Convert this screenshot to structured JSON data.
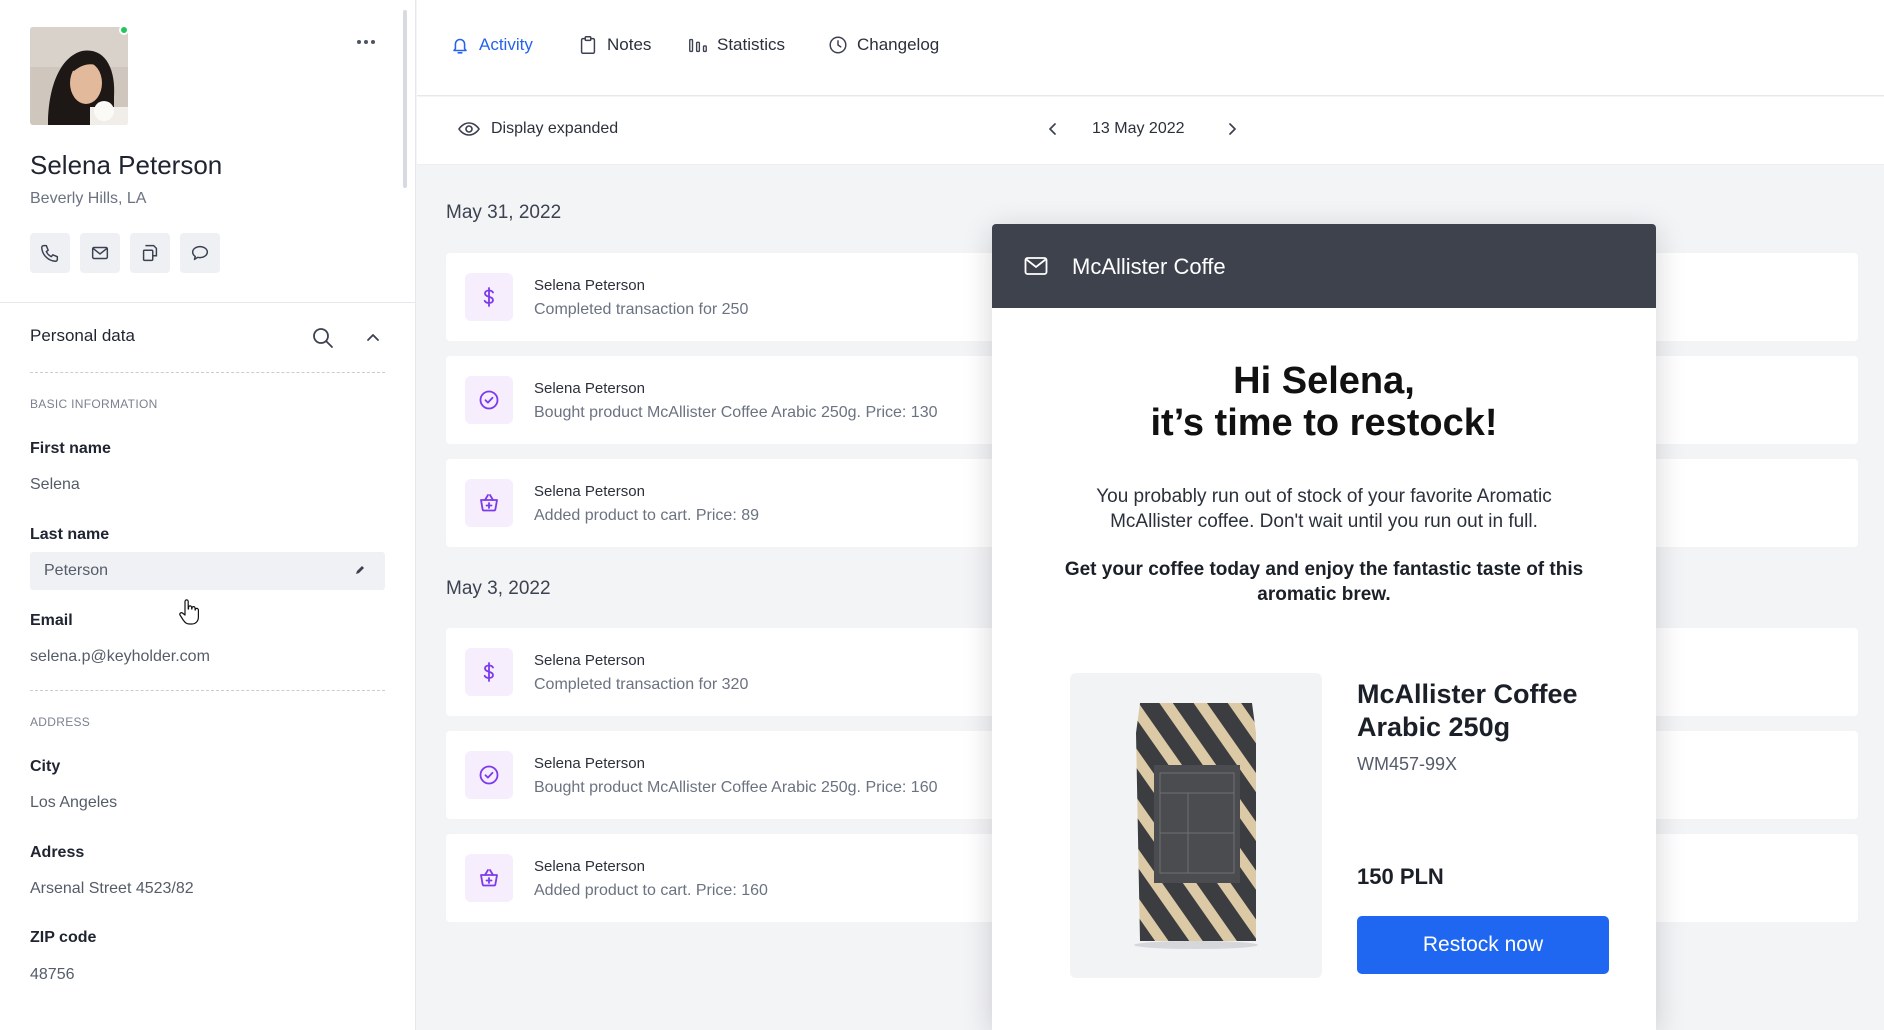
{
  "profile": {
    "name": "Selena Peterson",
    "location": "Beverly Hills, LA",
    "more_icon": "more-horizontal-icon",
    "online_status_color": "#22c55e",
    "contact_actions": [
      "phone-icon",
      "mail-icon",
      "copy-icon",
      "chat-icon"
    ]
  },
  "personal_data": {
    "title": "Personal data",
    "basic_label": "BASIC INFORMATION",
    "first_name_label": "First name",
    "first_name_value": "Selena",
    "last_name_label": "Last name",
    "last_name_value": "Peterson",
    "email_label": "Email",
    "email_value": "selena.p@keyholder.com",
    "address_label": "ADDRESS",
    "city_label": "City",
    "city_value": "Los Angeles",
    "adress_label": "Adress",
    "adress_value": "Arsenal Street 4523/82",
    "zip_label": "ZIP code",
    "zip_value": "48756"
  },
  "tabs": [
    {
      "label": "Activity",
      "icon": "bell-icon",
      "active": true
    },
    {
      "label": "Notes",
      "icon": "clipboard-icon",
      "active": false
    },
    {
      "label": "Statistics",
      "icon": "bar-chart-icon",
      "active": false
    },
    {
      "label": "Changelog",
      "icon": "clock-icon",
      "active": false
    }
  ],
  "toolbar": {
    "display_label": "Display expanded",
    "date": "13 May 2022"
  },
  "activity_groups": [
    {
      "date": "May 31, 2022",
      "items": [
        {
          "icon": "dollar-icon",
          "user": "Selena Peterson",
          "text": "Completed transaction for 250"
        },
        {
          "icon": "check-circle-icon",
          "user": "Selena Peterson",
          "text": "Bought product McAllister Coffee Arabic 250g. Price: 130"
        },
        {
          "icon": "cart-plus-icon",
          "user": "Selena Peterson",
          "text": "Added product to cart. Price: 89"
        }
      ]
    },
    {
      "date": "May 3, 2022",
      "items": [
        {
          "icon": "dollar-icon",
          "user": "Selena Peterson",
          "text": "Completed transaction for 320"
        },
        {
          "icon": "check-circle-icon",
          "user": "Selena Peterson",
          "text": "Bought product McAllister Coffee Arabic 250g. Price: 160"
        },
        {
          "icon": "cart-plus-icon",
          "user": "Selena Peterson",
          "text": "Added product to cart. Price: 160"
        }
      ]
    }
  ],
  "email": {
    "sender": "McAllister Coffe",
    "headline_1": "Hi Selena,",
    "headline_2": "it’s time to restock!",
    "body": "You probably run out of stock of your favorite Aromatic McAllister coffee. Don't wait until you run out in full.",
    "cta_text": "Get your coffee today and enjoy the fantastic taste of this aromatic brew.",
    "product_name": "McAllister Coffee Arabic 250g",
    "product_sku": "WM457-99X",
    "product_price": "150 PLN",
    "button_label": "Restock now",
    "button_color": "#1f66f0"
  },
  "colors": {
    "accent": "#2563eb",
    "icon_purple": "#7c3aed",
    "icon_bg": "#f6edfd",
    "email_header": "#3d424d"
  }
}
